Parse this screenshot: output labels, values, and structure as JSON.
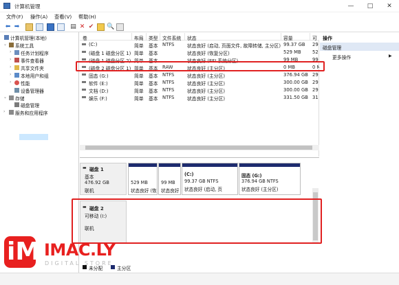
{
  "window": {
    "title": "计算机管理",
    "controls": {
      "minimize": "—",
      "maximize": "□",
      "close": "✕"
    }
  },
  "menu": [
    "文件(F)",
    "操作(A)",
    "查看(V)",
    "帮助(H)"
  ],
  "toolbar_icons": [
    "back-icon",
    "forward-icon",
    "up-folder-icon",
    "show-hide-tree-icon",
    "properties-icon",
    "help-icon",
    "view-icon",
    "delete-icon",
    "check-icon",
    "folder-icon",
    "zoom-icon",
    "properties-icon"
  ],
  "tree": [
    {
      "label": "计算机管理(本地)"
    },
    {
      "label": "系统工具"
    },
    {
      "label": "任务计划程序"
    },
    {
      "label": "事件查看器"
    },
    {
      "label": "共享文件夹"
    },
    {
      "label": "本地用户和组"
    },
    {
      "label": "性能"
    },
    {
      "label": "设备管理器"
    },
    {
      "label": "存储"
    },
    {
      "label": "磁盘管理"
    },
    {
      "label": "服务和应用程序"
    }
  ],
  "volume_list": {
    "columns": [
      "卷",
      "布局",
      "类型",
      "文件系统",
      "状态",
      "容量",
      "可"
    ],
    "rows": [
      [
        "(C:)",
        "简单",
        "基本",
        "NTFS",
        "状态良好 (启动, 页面文件, 故障转储, 主分区)",
        "99.37 GB",
        "29"
      ],
      [
        "(磁盘 1 磁盘分区 1)",
        "简单",
        "基本",
        "",
        "状态良好 (恢复分区)",
        "529 MB",
        "52"
      ],
      [
        "(磁盘 1 磁盘分区 2)",
        "简单",
        "基本",
        "",
        "状态良好 (EFI 系统分区)",
        "99 MB",
        "99"
      ],
      [
        "(磁盘 2 磁盘分区 1)",
        "简单",
        "基本",
        "RAW",
        "状态良好 (主分区)",
        "0 MB",
        "0 M"
      ],
      [
        "固态 (G:)",
        "简单",
        "基本",
        "NTFS",
        "状态良好 (主分区)",
        "376.94 GB",
        "29"
      ],
      [
        "软件 (E:)",
        "简单",
        "基本",
        "NTFS",
        "状态良好 (主分区)",
        "300.00 GB",
        "29"
      ],
      [
        "文档 (D:)",
        "简单",
        "基本",
        "NTFS",
        "状态良好 (主分区)",
        "300.00 GB",
        "29"
      ],
      [
        "娱乐 (F:)",
        "简单",
        "基本",
        "NTFS",
        "状态良好 (主分区)",
        "331.50 GB",
        "31"
      ]
    ]
  },
  "disk_map": {
    "disk1": {
      "name": "磁盘 1",
      "type": "基本",
      "size": "476.92 GB",
      "status": "联机",
      "partitions": [
        {
          "label": "",
          "size": "529 MB",
          "status": "状态良好 (恢"
        },
        {
          "label": "",
          "size": "99 MB",
          "status": "状态良好"
        },
        {
          "label": "(C:)",
          "size": "99.37 GB NTFS",
          "status": "状态良好 (启动, 页"
        },
        {
          "label": "固态  (G:)",
          "size": "376.94 GB NTFS",
          "status": "状态良好 (主分区)"
        }
      ]
    },
    "disk2": {
      "name": "磁盘 2",
      "type": "可移动 (I:)",
      "status": "联机"
    }
  },
  "legend": [
    {
      "label": "未分配"
    },
    {
      "label": "主分区"
    }
  ],
  "actions_pane": {
    "title": "操作",
    "section": "磁盘管理",
    "item": "更多操作"
  },
  "watermark": {
    "text": "IMAC.LY",
    "subtext": "DIGITAL STORE",
    "tile_letter": "iM"
  },
  "colors": {
    "accent_red": "#e8201f",
    "partition_bar": "#1d2b6e",
    "selection": "#cce8ff",
    "highlight_box": "#e02020"
  }
}
